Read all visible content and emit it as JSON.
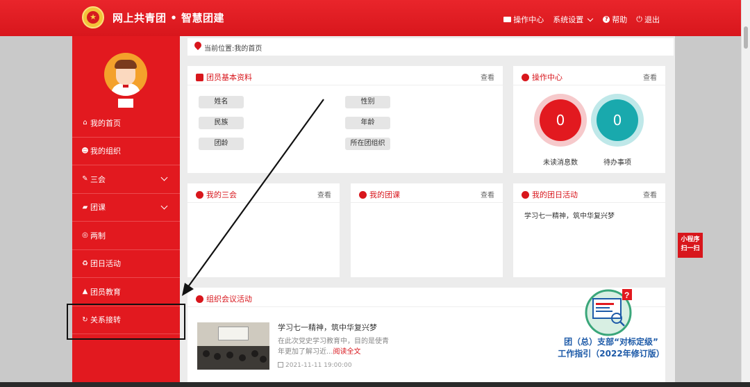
{
  "header": {
    "brand": "网上共青团 • 智慧团建",
    "nav": [
      {
        "label": "操作中心",
        "icon": "mail-icon"
      },
      {
        "label": "系统设置",
        "icon": "chevron-down-icon"
      },
      {
        "label": "帮助",
        "icon": "help-icon"
      },
      {
        "label": "退出",
        "icon": "power-icon"
      }
    ]
  },
  "sidebar": {
    "items": [
      {
        "label": "我的首页",
        "icon": "home-icon",
        "expandable": false
      },
      {
        "label": "我的组织",
        "icon": "group-icon",
        "expandable": false
      },
      {
        "label": "三会",
        "icon": "edit-icon",
        "expandable": true
      },
      {
        "label": "团课",
        "icon": "folder-icon",
        "expandable": true
      },
      {
        "label": "两制",
        "icon": "target-icon",
        "expandable": false
      },
      {
        "label": "团日活动",
        "icon": "recycle-icon",
        "expandable": false
      },
      {
        "label": "团员教育",
        "icon": "graduation-cap-icon",
        "expandable": false
      },
      {
        "label": "关系接转",
        "icon": "refresh-icon",
        "expandable": false
      }
    ]
  },
  "breadcrumb": "当前位置:我的首页",
  "profile_card": {
    "title": "团员基本资料",
    "more": "查看",
    "fields": [
      "姓名",
      "民族",
      "团龄",
      "性别",
      "年龄",
      "所在团组织"
    ]
  },
  "ops_card": {
    "title": "操作中心",
    "more": "查看",
    "unread_count": "0",
    "unread_label": "未读消息数",
    "todo_count": "0",
    "todo_label": "待办事项"
  },
  "sanhui_card": {
    "title": "我的三会",
    "more": "查看"
  },
  "tuanke_card": {
    "title": "我的团课",
    "more": "查看"
  },
  "tuanri_card": {
    "title": "我的团日活动",
    "more": "查看",
    "item": "学习七一精神，筑中华复兴梦"
  },
  "meeting_card": {
    "title": "组织会议活动",
    "item_title": "学习七一精神，筑中华复兴梦",
    "item_desc": "在此次党史学习教育中，目的是使青年更加了解习近...",
    "read_more": "阅读全文",
    "item_date": "2021-11-11 19:00:00",
    "promo_line1": "团（总）支部“对标定级”",
    "promo_line2": "工作指引（2022年修订版）"
  },
  "mini_program": {
    "line1": "小程序",
    "line2": "扫一扫"
  },
  "colors": {
    "brand_red": "#e2191f",
    "teal": "#19a9ad",
    "promo_blue": "#1d5aa8"
  }
}
